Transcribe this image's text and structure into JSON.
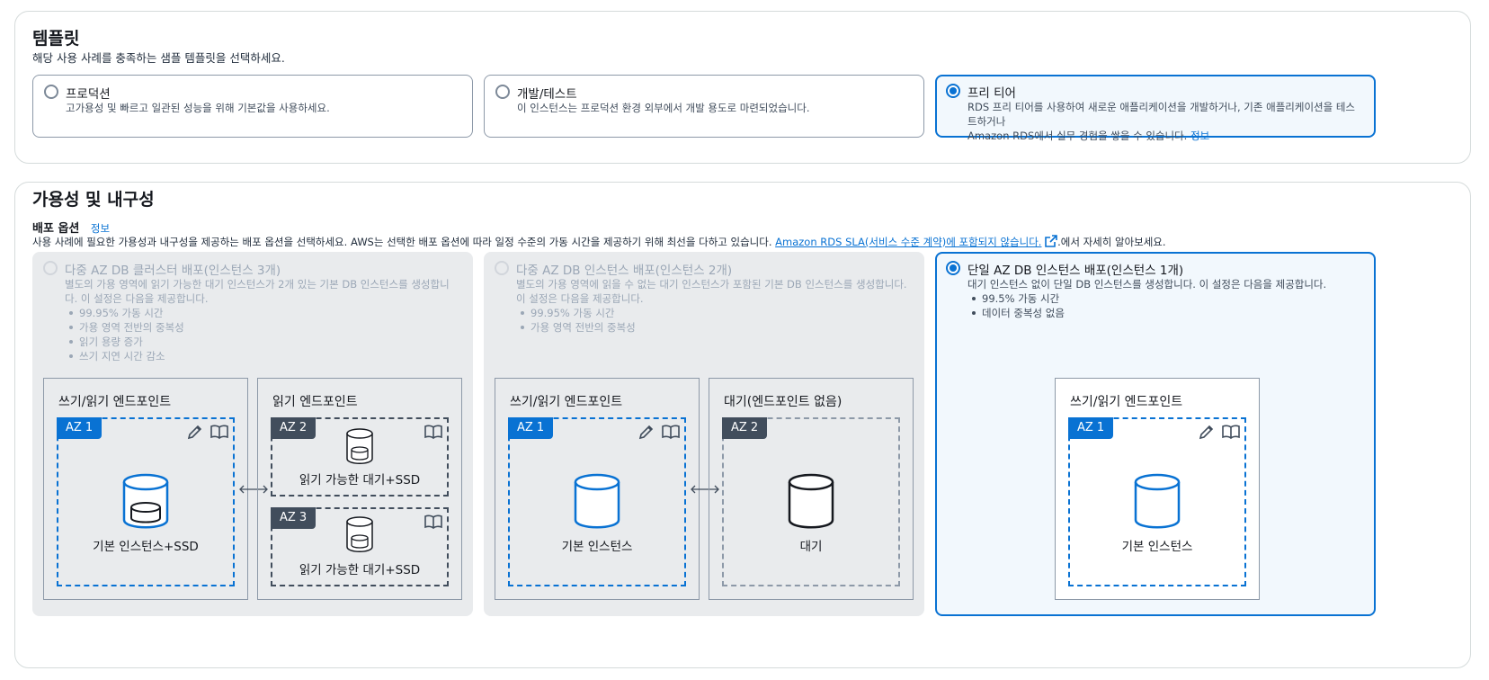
{
  "template_section": {
    "title": "템플릿",
    "description": "해당 사용 사례를 충족하는 샘플 템플릿을 선택하세요.",
    "options": [
      {
        "label": "프로덕션",
        "description": "고가용성 및 빠르고 일관된 성능을 위해 기본값을 사용하세요.",
        "selected": false
      },
      {
        "label": "개발/테스트",
        "description": "이 인스턴스는 프로덕션 환경 외부에서 개발 용도로 마련되었습니다.",
        "selected": false
      },
      {
        "label": "프리 티어",
        "description_line1": "RDS 프리 티어를 사용하여 새로운 애플리케이션을 개발하거나, 기존 애플리케이션을 테스트하거나",
        "description_line2": "Amazon RDS에서 실무 경험을 쌓을 수 있습니다.",
        "info_link": "정보",
        "selected": true
      }
    ]
  },
  "availability_section": {
    "title": "가용성 및 내구성",
    "deploy_label": "배포 옵션",
    "info_link": "정보",
    "description_prefix": "사용 사례에 필요한 가용성과 내구성을 제공하는 배포 옵션을 선택하세요. AWS는 선택한 배포 옵션에 따라 일정 수준의 가동 시간을 제공하기 위해 최선을 다하고 있습니다.",
    "sla_link": "Amazon RDS SLA(서비스 수준 계약)에 포함되지 않습니다.",
    "description_suffix": ".에서 자세히 알아보세요.",
    "options": [
      {
        "label": "다중 AZ DB 클러스터 배포(인스턴스 3개)",
        "description": "별도의 가용 영역에 읽기 가능한 대기 인스턴스가 2개 있는 기본 DB 인스턴스를 생성합니다. 이 설정은 다음을 제공합니다.",
        "bullets": [
          "99.95% 가동 시간",
          "가용 영역 전반의 중복성",
          "읽기 용량 증가",
          "쓰기 지연 시간 감소"
        ],
        "disabled": true,
        "diagram": {
          "left_title": "쓰기/읽기 엔드포인트",
          "left_az": "AZ 1",
          "left_db": "기본 인스턴스+SSD",
          "right_title": "읽기 엔드포인트",
          "right_az_top": "AZ 2",
          "right_db_top": "읽기 가능한 대기+SSD",
          "right_az_bottom": "AZ 3",
          "right_db_bottom": "읽기 가능한 대기+SSD"
        }
      },
      {
        "label": "다중 AZ DB 인스턴스 배포(인스턴스 2개)",
        "description": "별도의 가용 영역에 읽을 수 없는 대기 인스턴스가 포함된 기본 DB 인스턴스를 생성합니다. 이 설정은 다음을 제공합니다.",
        "bullets": [
          "99.95% 가동 시간",
          "가용 영역 전반의 중복성"
        ],
        "disabled": true,
        "diagram": {
          "left_title": "쓰기/읽기 엔드포인트",
          "left_az": "AZ 1",
          "left_db": "기본 인스턴스",
          "right_title": "대기(엔드포인트 없음)",
          "right_az": "AZ 2",
          "right_db": "대기"
        }
      },
      {
        "label": "단일 AZ DB 인스턴스 배포(인스턴스 1개)",
        "description": "대기 인스턴스 없이 단일 DB 인스턴스를 생성합니다. 이 설정은 다음을 제공합니다.",
        "bullets": [
          "99.5% 가동 시간",
          "데이터 중복성 없음"
        ],
        "disabled": false,
        "selected": true,
        "diagram": {
          "title": "쓰기/읽기 엔드포인트",
          "az": "AZ 1",
          "db": "기본 인스턴스"
        }
      }
    ]
  },
  "icons": [
    "pencil-icon",
    "book-icon",
    "database-icon",
    "external-link-icon",
    "double-arrow-icon"
  ],
  "colors": {
    "accent": "#0972d3",
    "selected_bg": "#f2f8fd",
    "disabled_bg": "#e9ebed",
    "dark_badge": "#414d5c"
  }
}
